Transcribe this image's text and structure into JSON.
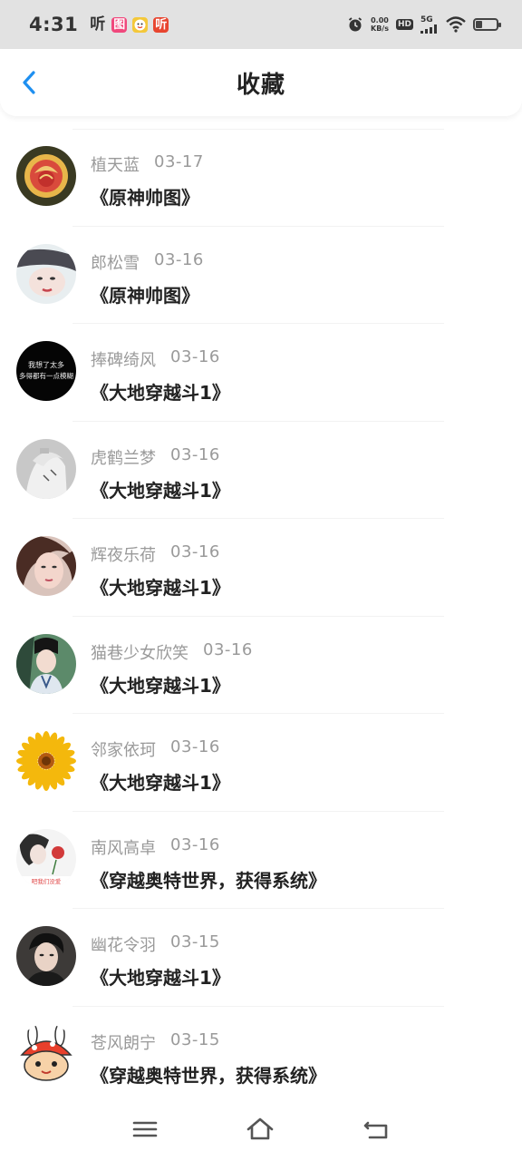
{
  "status_bar": {
    "time": "4:31",
    "notifications": [
      "听",
      "图",
      "",
      "听"
    ],
    "net_speed_value": "0.00",
    "net_speed_unit": "KB/s",
    "hd_label": "HD",
    "signal_label": "5G",
    "battery_level": 0.3
  },
  "header": {
    "title": "收藏",
    "back_icon": "chevron-left-icon",
    "accent_color": "#1e8ff0"
  },
  "favorites": [
    {
      "user": "植天蓝",
      "date": "03-17",
      "title": "《原神帅图》",
      "avatar": "rose"
    },
    {
      "user": "郎松雪",
      "date": "03-16",
      "title": "《原神帅图》",
      "avatar": "girl-face"
    },
    {
      "user": "捧碑绮风",
      "date": "03-16",
      "title": "《大地穿越斗1》",
      "avatar": "black-text",
      "avatar_text": [
        "我想了太多",
        "多得都有一点模糊"
      ]
    },
    {
      "user": "虎鹤兰梦",
      "date": "03-16",
      "title": "《大地穿越斗1》",
      "avatar": "anime-boy"
    },
    {
      "user": "辉夜乐荷",
      "date": "03-16",
      "title": "《大地穿越斗1》",
      "avatar": "woman-portrait"
    },
    {
      "user": "猫巷少女欣笑",
      "date": "03-16",
      "title": "《大地穿越斗1》",
      "avatar": "costume-man"
    },
    {
      "user": "邻家依珂",
      "date": "03-16",
      "title": "《大地穿越斗1》",
      "avatar": "sunflower"
    },
    {
      "user": "南风高卓",
      "date": "03-16",
      "title": "《穿越奥特世界，获得系统》",
      "avatar": "girl-flower",
      "avatar_text": [
        "吧我们没爱"
      ]
    },
    {
      "user": "幽花令羽",
      "date": "03-15",
      "title": "《大地穿越斗1》",
      "avatar": "young-man"
    },
    {
      "user": "苍风朗宁",
      "date": "03-15",
      "title": "《穿越奥特世界，获得系统》",
      "avatar": "cartoon-rabbit"
    }
  ],
  "nav": {
    "menu_icon": "menu-icon",
    "home_icon": "home-icon",
    "back_icon": "back-icon"
  }
}
